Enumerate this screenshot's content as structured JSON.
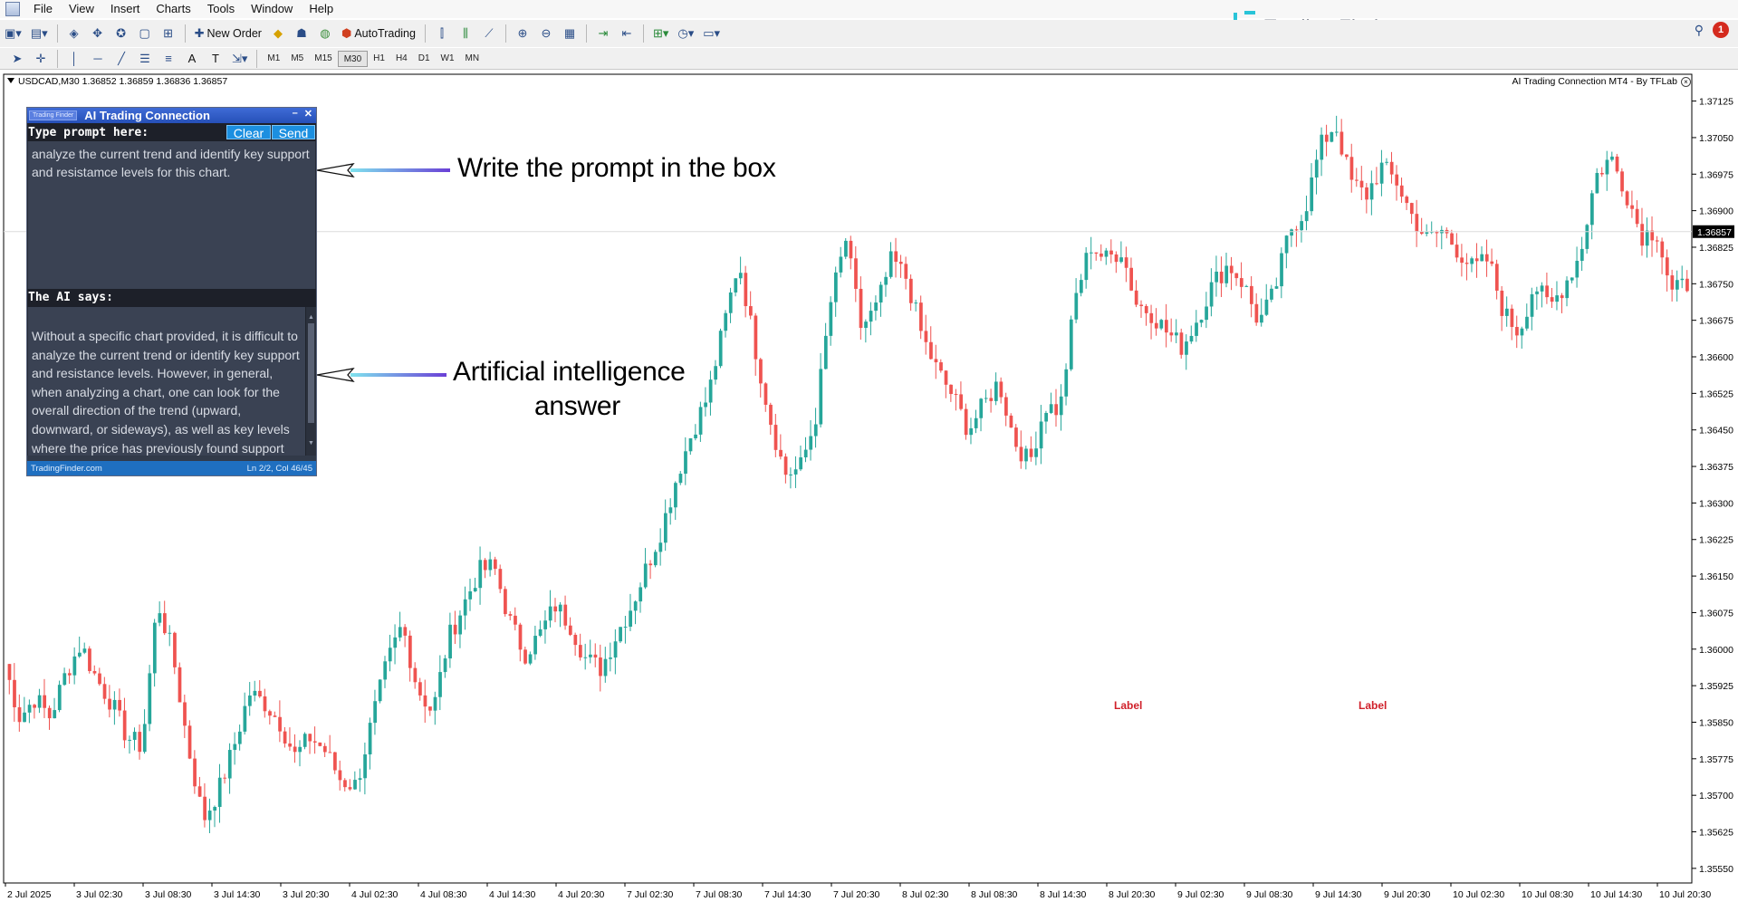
{
  "menu": [
    "File",
    "View",
    "Insert",
    "Charts",
    "Tools",
    "Window",
    "Help"
  ],
  "toolbar": {
    "new_order": "New Order",
    "auto_trading": "AutoTrading",
    "timeframes": [
      "M1",
      "M5",
      "M15",
      "M30",
      "H1",
      "H4",
      "D1",
      "W1",
      "MN"
    ],
    "active_timeframe": "M30"
  },
  "brand": {
    "name": "Trading Finder"
  },
  "notifications": {
    "count": "1"
  },
  "chart": {
    "symbol_line": "USDCAD,M30  1.36852 1.36859 1.36836 1.36857",
    "indicator_name": "AI Trading Connection MT4 - By TFLab",
    "current_price": "1.36857",
    "price_ticks": [
      "1.37125",
      "1.37050",
      "1.36975",
      "1.36900",
      "1.36825",
      "1.36750",
      "1.36675",
      "1.36600",
      "1.36525",
      "1.36450",
      "1.36375",
      "1.36300",
      "1.36225",
      "1.36150",
      "1.36075",
      "1.36000",
      "1.35925",
      "1.35850",
      "1.35775",
      "1.35700",
      "1.35625",
      "1.35550"
    ],
    "time_ticks": [
      "2 Jul 2025",
      "3 Jul 02:30",
      "3 Jul 08:30",
      "3 Jul 14:30",
      "3 Jul 20:30",
      "4 Jul 02:30",
      "4 Jul 08:30",
      "4 Jul 14:30",
      "4 Jul 20:30",
      "7 Jul 02:30",
      "7 Jul 08:30",
      "7 Jul 14:30",
      "7 Jul 20:30",
      "8 Jul 02:30",
      "8 Jul 08:30",
      "8 Jul 14:30",
      "8 Jul 20:30",
      "9 Jul 02:30",
      "9 Jul 08:30",
      "9 Jul 14:30",
      "9 Jul 20:30",
      "10 Jul 02:30",
      "10 Jul 08:30",
      "10 Jul 14:30",
      "10 Jul 20:30"
    ],
    "labels": [
      "Label",
      "Label"
    ],
    "colors": {
      "bull": "#26a69a",
      "bear": "#ef5350",
      "axis": "#000000"
    }
  },
  "chart_data": {
    "type": "candlestick",
    "ylim": [
      1.3552,
      1.3718
    ],
    "close_path": [
      1.3597,
      1.3586,
      1.359,
      1.3586,
      1.3595,
      1.3601,
      1.3594,
      1.3589,
      1.3582,
      1.358,
      1.361,
      1.3599,
      1.358,
      1.3565,
      1.3571,
      1.358,
      1.3591,
      1.3589,
      1.3585,
      1.3578,
      1.3582,
      1.3579,
      1.3573,
      1.3572,
      1.3585,
      1.3597,
      1.3605,
      1.3592,
      1.3587,
      1.3602,
      1.3609,
      1.3616,
      1.3617,
      1.3606,
      1.3599,
      1.3603,
      1.3609,
      1.3605,
      1.3598,
      1.3596,
      1.3603,
      1.3609,
      1.3617,
      1.3625,
      1.3636,
      1.3645,
      1.3652,
      1.3666,
      1.368,
      1.3663,
      1.3648,
      1.3636,
      1.3637,
      1.3647,
      1.3671,
      1.3684,
      1.3666,
      1.367,
      1.368,
      1.3676,
      1.3664,
      1.3657,
      1.3652,
      1.3645,
      1.365,
      1.3655,
      1.3643,
      1.3638,
      1.365,
      1.3649,
      1.3672,
      1.3683,
      1.368,
      1.3682,
      1.3671,
      1.3669,
      1.3665,
      1.3662,
      1.3668,
      1.3675,
      1.3679,
      1.3675,
      1.3667,
      1.3673,
      1.3686,
      1.369,
      1.3703,
      1.3708,
      1.3696,
      1.3693,
      1.3699,
      1.3696,
      1.3689,
      1.3684,
      1.3686,
      1.3682,
      1.3678,
      1.368,
      1.3669,
      1.3665,
      1.3675,
      1.367,
      1.3675,
      1.3681,
      1.3697,
      1.3701,
      1.3694,
      1.3685,
      1.3686,
      1.3673,
      1.3675
    ],
    "time_range": [
      "2 Jul 2025",
      "10 Jul 20:30"
    ]
  },
  "panel": {
    "title": "AI Trading Connection",
    "logo_text": "Trading Finder",
    "prompt_label": "Type prompt here:",
    "clear_label": "Clear",
    "send_label": "Send",
    "prompt_text": "analyze the current trend and identify key support and resistamce levels for this chart.",
    "ai_label": "The AI says:",
    "ai_text": "Without a specific chart provided, it is difficult to analyze the current trend or identify key support and resistance levels. However, in general, when analyzing a chart, one can look for the overall direction of the trend (upward, downward, or sideways), as well as key levels where the price has previously found support",
    "status_left": "TradingFinder.com",
    "status_right": "Ln 2/2, Col 46/45"
  },
  "callouts": {
    "prompt": "Write the prompt in the box",
    "answer_line1": "Artificial intelligence",
    "answer_line2": "answer"
  }
}
